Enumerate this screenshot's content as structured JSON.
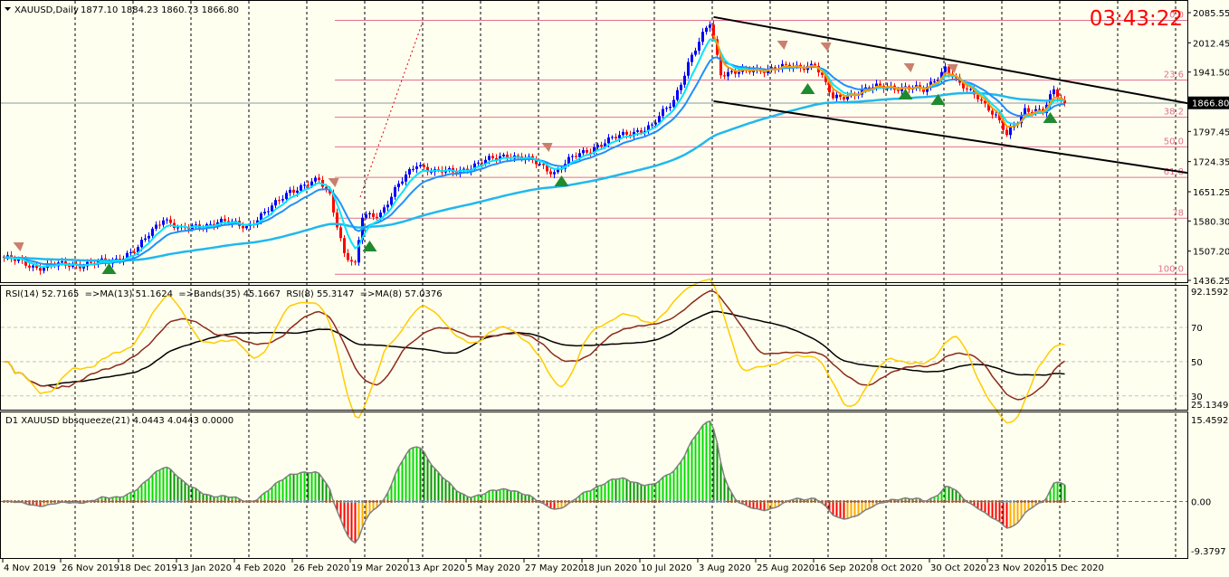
{
  "header": {
    "symbol_label": "XAUUSD,Daily",
    "ohlc": "1877.10 1884.23 1860.73 1866.80"
  },
  "clock": "03:43:22",
  "colors": {
    "up": "#0000ff",
    "down": "#ff0000",
    "fib": "#e07090",
    "clock": "#ff0000",
    "ma_fast": "#00e5ff",
    "ma_mid": "#1e90ff",
    "ma_slow": "#20b8ee",
    "ma_orange": "#ff9900",
    "rsi_yellow": "#ffcc00",
    "rsi_brown": "#8b2a1a",
    "bands_black": "#000000"
  },
  "rsi_pane": {
    "label": "RSI(14) 52.7165  =>MA(13) 51.1624  =>Bands(35) 45.1667  RSI(8) 55.3147  =>MA(8) 57.0376",
    "ticks": [
      "92.1592",
      "70",
      "50",
      "30",
      "25.1349"
    ]
  },
  "squeeze_pane": {
    "label": "D1 XAUUSD bbsqueeze(21) 4.0443 4.0443 0.0000",
    "ticks": [
      "15.4592",
      "0.00",
      "-9.3797"
    ]
  },
  "chart_data": {
    "type": "candlestick",
    "title": "XAUUSD,Daily",
    "ylim": [
      1436.25,
      2085.55
    ],
    "y_ticks": [
      "2085.55",
      "2012.45",
      "1941.50",
      "1866.80",
      "1797.45",
      "1724.35",
      "1651.25",
      "1580.30",
      "1507.20",
      "1436.25"
    ],
    "current_price": "1866.80",
    "x_ticks": [
      "4 Nov 2019",
      "26 Nov 2019",
      "18 Dec 2019",
      "13 Jan 2020",
      "4 Feb 2020",
      "26 Feb 2020",
      "19 Mar 2020",
      "13 Apr 2020",
      "5 May 2020",
      "27 May 2020",
      "18 Jun 2020",
      "10 Jul 2020",
      "3 Aug 2020",
      "25 Aug 2020",
      "16 Sep 2020",
      "8 Oct 2020",
      "30 Oct 2020",
      "23 Nov 2020",
      "15 Dec 2020"
    ],
    "bars_per_tick": 16,
    "close_path_keypoints": [
      [
        0,
        1491
      ],
      [
        9,
        1469
      ],
      [
        29,
        1480
      ],
      [
        37,
        1513
      ],
      [
        44,
        1590
      ],
      [
        49,
        1557
      ],
      [
        59,
        1579
      ],
      [
        67,
        1568
      ],
      [
        74,
        1612
      ],
      [
        79,
        1656
      ],
      [
        87,
        1677
      ],
      [
        90,
        1645
      ],
      [
        94,
        1502
      ],
      [
        97,
        1469
      ],
      [
        99,
        1590
      ],
      [
        104,
        1601
      ],
      [
        109,
        1666
      ],
      [
        114,
        1721
      ],
      [
        119,
        1699
      ],
      [
        124,
        1699
      ],
      [
        132,
        1721
      ],
      [
        139,
        1743
      ],
      [
        147,
        1721
      ],
      [
        152,
        1699
      ],
      [
        157,
        1732
      ],
      [
        164,
        1765
      ],
      [
        174,
        1798
      ],
      [
        179,
        1809
      ],
      [
        185,
        1875
      ],
      [
        189,
        1963
      ],
      [
        195,
        2061
      ],
      [
        198,
        1941
      ],
      [
        204,
        1941
      ],
      [
        212,
        1952
      ],
      [
        219,
        1952
      ],
      [
        224,
        1963
      ],
      [
        229,
        1875
      ],
      [
        237,
        1897
      ],
      [
        244,
        1908
      ],
      [
        254,
        1897
      ],
      [
        260,
        1952
      ],
      [
        264,
        1908
      ],
      [
        269,
        1886
      ],
      [
        274,
        1831
      ],
      [
        277,
        1787
      ],
      [
        282,
        1853
      ],
      [
        287,
        1842
      ],
      [
        290,
        1897
      ],
      [
        293,
        1866.8
      ]
    ],
    "fibonacci": {
      "levels": [
        "0.0",
        "23.6",
        "38.2",
        "50.0",
        "61.8",
        "78",
        "100.0"
      ],
      "prices": [
        2067,
        1922,
        1832,
        1760,
        1686,
        1587,
        1451
      ]
    },
    "channel": {
      "upper": [
        [
          196,
          2075
        ],
        [
          327,
          1866
        ]
      ],
      "lower": [
        [
          196,
          1871
        ],
        [
          327,
          1697
        ]
      ]
    },
    "rsi": {
      "ylim": [
        25.1349,
        92.1592
      ],
      "levels": [
        70,
        50,
        30
      ]
    },
    "bbsqueeze": {
      "ylim": [
        -9.3797,
        15.4592
      ]
    }
  }
}
